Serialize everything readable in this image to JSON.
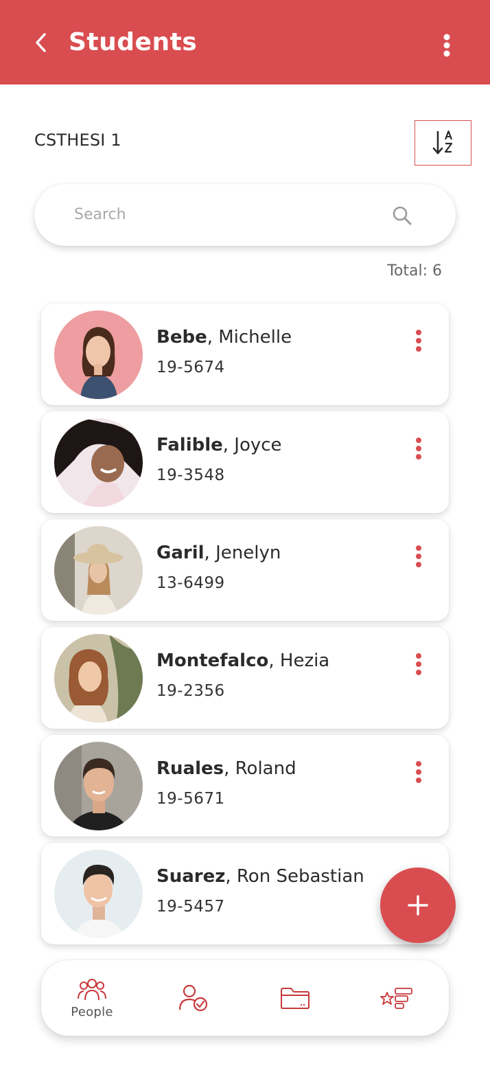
{
  "app_bar": {
    "title": "Students",
    "back_icon": "chevron-left-icon",
    "more_icon": "more-vertical-icon"
  },
  "class_name": "CSTHESI 1",
  "sort_button": {
    "icon": "sort-alpha-icon"
  },
  "search": {
    "placeholder": "Search",
    "value": ""
  },
  "total_label": "Total: 6",
  "students": [
    {
      "last_name": "Bebe",
      "first_name": "Michelle",
      "id": "19-5674",
      "has_menu": true
    },
    {
      "last_name": "Falible",
      "first_name": "Joyce",
      "id": "19-3548",
      "has_menu": true
    },
    {
      "last_name": "Garil",
      "first_name": "Jenelyn",
      "id": "13-6499",
      "has_menu": true
    },
    {
      "last_name": "Montefalco",
      "first_name": "Hezia",
      "id": "19-2356",
      "has_menu": true
    },
    {
      "last_name": "Ruales",
      "first_name": "Roland",
      "id": "19-5671",
      "has_menu": true
    },
    {
      "last_name": "Suarez",
      "first_name": "Ron Sebastian",
      "id": "19-5457",
      "has_menu": false
    }
  ],
  "fab": {
    "icon": "plus-icon"
  },
  "bottom_nav": {
    "items": [
      {
        "label": "People",
        "icon": "people-icon"
      },
      {
        "label": "",
        "icon": "user-check-icon"
      },
      {
        "label": "",
        "icon": "folder-icon"
      },
      {
        "label": "",
        "icon": "ranking-list-icon"
      }
    ]
  },
  "colors": {
    "primary": "#d94d50",
    "background": "#ffffff",
    "text": "#2b2b2b"
  }
}
